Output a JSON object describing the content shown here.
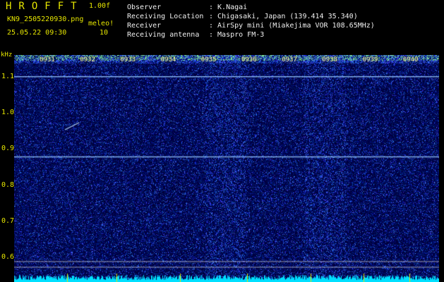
{
  "header": {
    "logo": "HROFFT",
    "version": "1.00f",
    "filename": "KN9_2505220930.png",
    "datetime": "25.05.22 09:30",
    "meleo_label": "meleo!",
    "meleo_value": "10"
  },
  "info": [
    {
      "label": "Observer",
      "value": ": K.Nagai"
    },
    {
      "label": "Receiving Location",
      "value": ": Chigasaki, Japan (139.414 35.340)"
    },
    {
      "label": "Receiver",
      "value": ": AirSpy mini (Miakejima VOR 108.65MHz)"
    },
    {
      "label": "Receiving antenna",
      "value": ": Maspro FM-3"
    }
  ],
  "spectrogram": {
    "unit": "kHz",
    "y_ticks": [
      "1.1",
      "1.0",
      "0.9",
      "0.8",
      "0.7",
      "0.6"
    ],
    "time_ticks": [
      "0931",
      "0932",
      "0933",
      "0934",
      "0935",
      "0936",
      "0937",
      "0938",
      "0939",
      "0940"
    ],
    "y_range_khz": [
      0.575,
      1.16
    ],
    "signal_lines_khz": [
      1.1,
      0.878
    ],
    "colors": {
      "background": "#00003c",
      "noise": "#2a3cff",
      "label": "#e6e600",
      "power": "#00e0ff"
    }
  }
}
